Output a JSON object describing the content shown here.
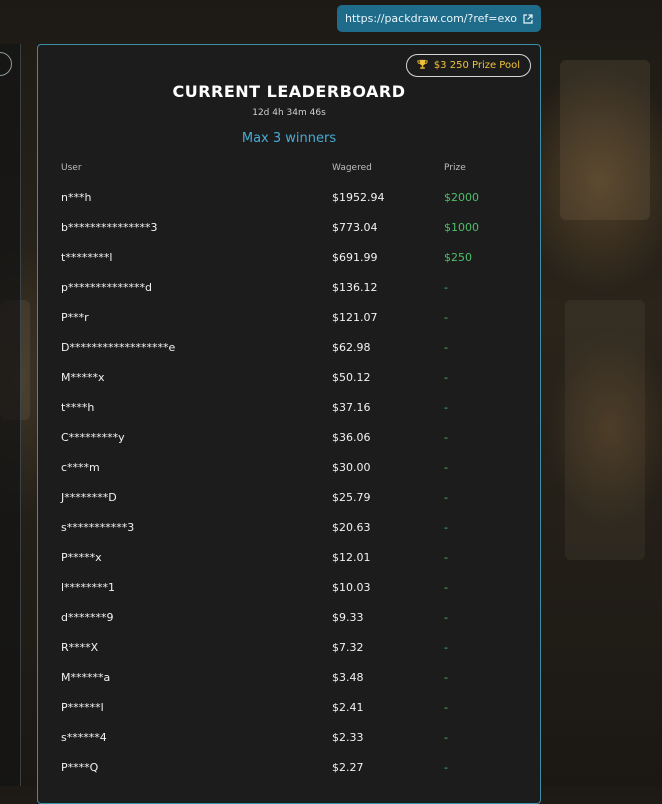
{
  "ref_link": {
    "text": "https://packdraw.com/?ref=exo"
  },
  "leaderboard": {
    "prize_pool": "$3 250 Prize Pool",
    "title": "CURRENT LEADERBOARD",
    "countdown": "12d 4h 34m 46s",
    "max_winners": "Max 3 winners",
    "columns": {
      "user": "User",
      "wagered": "Wagered",
      "prize": "Prize"
    },
    "rows": [
      {
        "user": "n***h",
        "wagered": "$1952.94",
        "prize": "$2000"
      },
      {
        "user": "b***************3",
        "wagered": "$773.04",
        "prize": "$1000"
      },
      {
        "user": "t********l",
        "wagered": "$691.99",
        "prize": "$250"
      },
      {
        "user": "p**************d",
        "wagered": "$136.12",
        "prize": "-"
      },
      {
        "user": "P***r",
        "wagered": "$121.07",
        "prize": "-"
      },
      {
        "user": "D******************e",
        "wagered": "$62.98",
        "prize": "-"
      },
      {
        "user": "M*****x",
        "wagered": "$50.12",
        "prize": "-"
      },
      {
        "user": "t****h",
        "wagered": "$37.16",
        "prize": "-"
      },
      {
        "user": "C*********y",
        "wagered": "$36.06",
        "prize": "-"
      },
      {
        "user": "c****m",
        "wagered": "$30.00",
        "prize": "-"
      },
      {
        "user": "J********D",
        "wagered": "$25.79",
        "prize": "-"
      },
      {
        "user": "s***********3",
        "wagered": "$20.63",
        "prize": "-"
      },
      {
        "user": "P*****x",
        "wagered": "$12.01",
        "prize": "-"
      },
      {
        "user": "l********1",
        "wagered": "$10.03",
        "prize": "-"
      },
      {
        "user": "d*******9",
        "wagered": "$9.33",
        "prize": "-"
      },
      {
        "user": "R****X",
        "wagered": "$7.32",
        "prize": "-"
      },
      {
        "user": "M******a",
        "wagered": "$3.48",
        "prize": "-"
      },
      {
        "user": "P******l",
        "wagered": "$2.41",
        "prize": "-"
      },
      {
        "user": "s******4",
        "wagered": "$2.33",
        "prize": "-"
      },
      {
        "user": "P****Q",
        "wagered": "$2.27",
        "prize": "-"
      }
    ]
  }
}
